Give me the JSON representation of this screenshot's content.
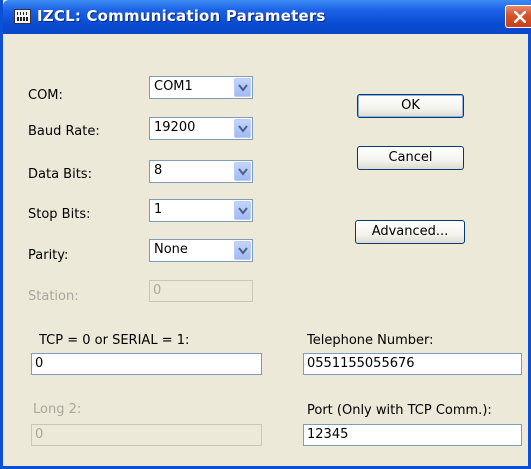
{
  "window": {
    "title": "IZCL: Communication Parameters"
  },
  "fields": {
    "com": {
      "label": "COM:",
      "value": "COM1"
    },
    "baud_rate": {
      "label": "Baud Rate:",
      "value": "19200"
    },
    "data_bits": {
      "label": "Data Bits:",
      "value": "8"
    },
    "stop_bits": {
      "label": "Stop Bits:",
      "value": "1"
    },
    "parity": {
      "label": "Parity:",
      "value": "None"
    },
    "station": {
      "label": "Station:",
      "value": "0",
      "disabled": true
    },
    "tcp_serial": {
      "label": "TCP = 0 or SERIAL = 1:",
      "value": "0"
    },
    "long2": {
      "label": "Long 2:",
      "value": "0",
      "disabled": true
    },
    "telephone": {
      "label": "Telephone Number:",
      "value": "0551155055676"
    },
    "port": {
      "label": "Port (Only with TCP Comm.):",
      "value": "12345"
    }
  },
  "buttons": {
    "ok": "OK",
    "cancel": "Cancel",
    "advanced": "Advanced..."
  },
  "icons": {
    "title": "app-icon",
    "close": "close-icon",
    "dropdown": "chevron-down-icon"
  },
  "colors": {
    "titlebar": "#0a4bd3",
    "window_bg": "#ece9d8",
    "close_button": "#d5532a",
    "input_border": "#7f9db9",
    "disabled_text": "#a8a79c"
  }
}
